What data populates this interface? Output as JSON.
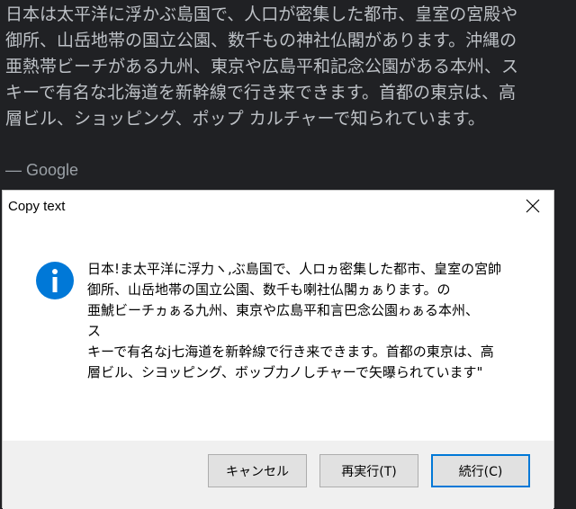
{
  "background": {
    "lines": [
      "日本は太平洋に浮かぶ島国で、人口が密集した都市、皇室の宮殿や",
      "御所、山岳地帯の国立公園、数千もの神社仏閣があります。沖縄の",
      "亜熱帯ビーチがある九州、東京や広島平和記念公園がある本州、ス",
      "キーで有名な北海道を新幹線で行き来できます。首都の東京は、高",
      "層ビル、ショッピング、ポップ カルチャーで知られています。"
    ],
    "attribution": "— Google"
  },
  "dialog": {
    "title": "Copy text",
    "message_lines": [
      "日本!ま太平洋に浮力ヽ,ぶ島国で、人ロヵ密集した都市、皇室の宮帥",
      "御所、山岳地帯の国立公園、数千も喇社仏閣ヵぁります。の",
      "亜鯱ビーチヵぁる九州、東京や広島平和言巴念公園ゎぁる本州、",
      "ス",
      "キーで有名なj七海道を新幹線で行き来できます。首都の東京は、高",
      "層ビル、シヨッピング、ボッブ力ノしチャーで矢曝られています\""
    ],
    "buttons": {
      "cancel": "キャンセル",
      "retry": "再実行(T)",
      "continue": "続行(C)"
    },
    "icon_color": "#0078d7"
  }
}
